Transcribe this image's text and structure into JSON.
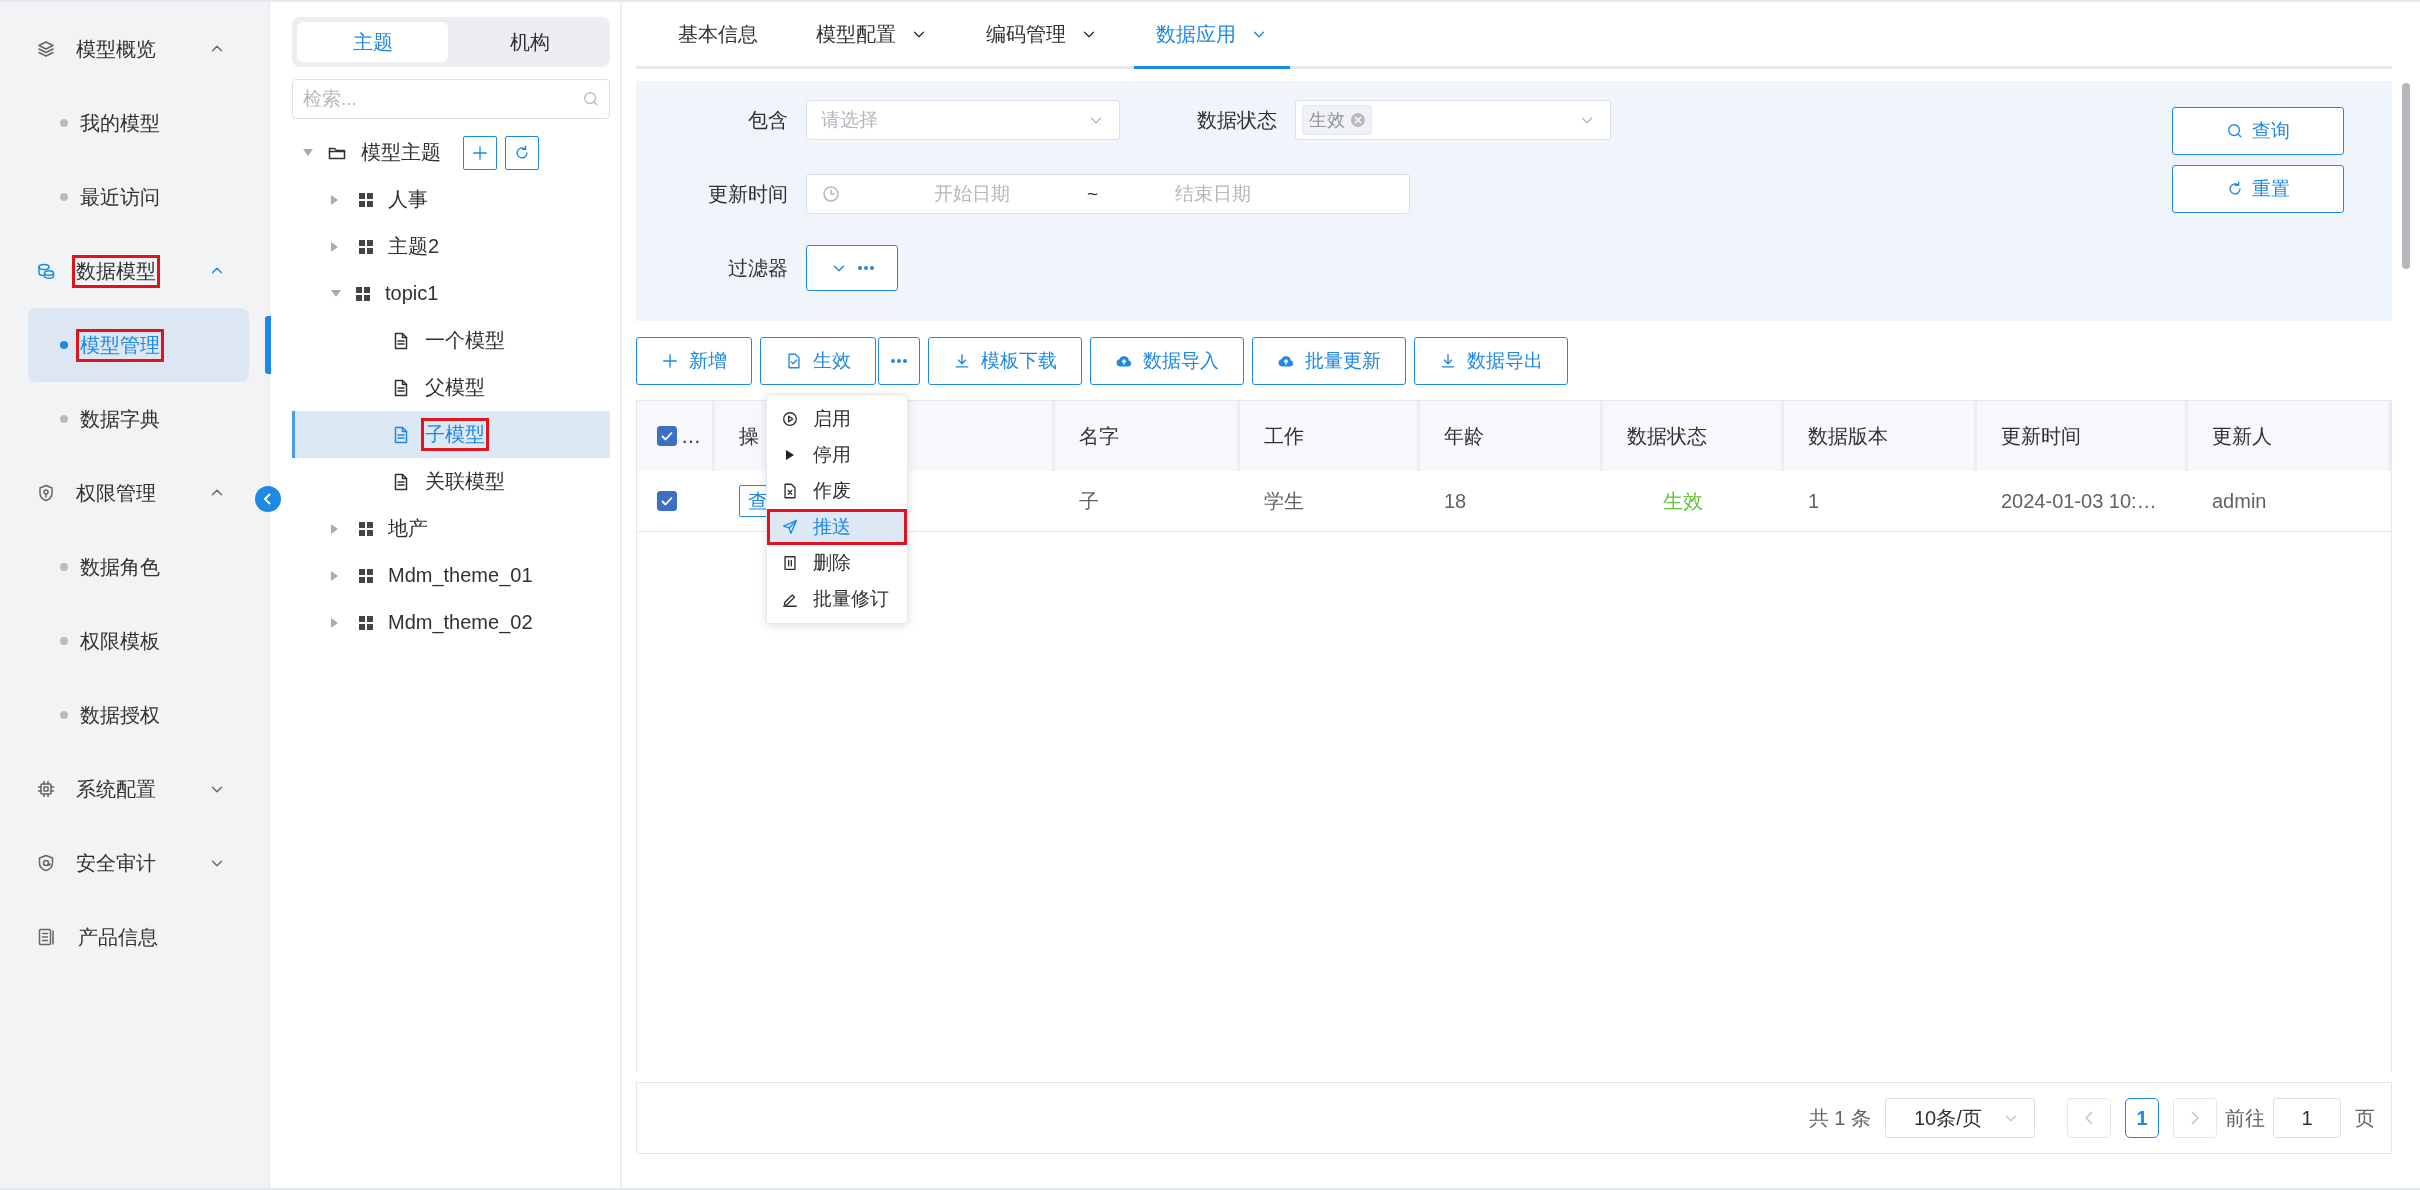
{
  "sidebar": {
    "items": [
      {
        "kind": "group",
        "label": "模型概览",
        "expanded": true,
        "selected": false,
        "highlighted": false
      },
      {
        "kind": "child",
        "label": "我的模型",
        "selected": false,
        "highlighted": false
      },
      {
        "kind": "child",
        "label": "最近访问",
        "selected": false,
        "highlighted": false
      },
      {
        "kind": "group",
        "label": "数据模型",
        "expanded": true,
        "selected": true,
        "highlighted": true
      },
      {
        "kind": "child",
        "label": "模型管理",
        "selected": true,
        "highlighted": true
      },
      {
        "kind": "child",
        "label": "数据字典",
        "selected": false,
        "highlighted": false
      },
      {
        "kind": "group",
        "label": "权限管理",
        "expanded": true,
        "selected": false,
        "highlighted": false
      },
      {
        "kind": "child",
        "label": "数据角色",
        "selected": false,
        "highlighted": false
      },
      {
        "kind": "child",
        "label": "权限模板",
        "selected": false,
        "highlighted": false
      },
      {
        "kind": "child",
        "label": "数据授权",
        "selected": false,
        "highlighted": false
      },
      {
        "kind": "group",
        "label": "系统配置",
        "expanded": false,
        "selected": false,
        "highlighted": false
      },
      {
        "kind": "group",
        "label": "安全审计",
        "expanded": false,
        "selected": false,
        "highlighted": false
      },
      {
        "kind": "link",
        "label": "产品信息",
        "selected": false,
        "highlighted": false
      }
    ]
  },
  "tree_panel": {
    "tabs": [
      {
        "label": "主题",
        "selected": true
      },
      {
        "label": "机构",
        "selected": false
      }
    ],
    "search": {
      "placeholder": "检索..."
    },
    "nodes": [
      {
        "kind": "root",
        "label": "模型主题",
        "expanded": true,
        "selected": false,
        "highlighted": false,
        "children": [
          {
            "kind": "topic",
            "label": "人事",
            "expanded": false,
            "selected": false,
            "highlighted": false
          },
          {
            "kind": "topic",
            "label": "主题2",
            "expanded": false,
            "selected": false,
            "highlighted": false
          },
          {
            "kind": "topic",
            "label": "topic1",
            "expanded": true,
            "selected": false,
            "highlighted": false,
            "children": [
              {
                "kind": "model",
                "label": "一个模型",
                "selected": false,
                "highlighted": false
              },
              {
                "kind": "model",
                "label": "父模型",
                "selected": false,
                "highlighted": false
              },
              {
                "kind": "model",
                "label": "子模型",
                "selected": true,
                "highlighted": true
              },
              {
                "kind": "model",
                "label": "关联模型",
                "selected": false,
                "highlighted": false
              }
            ]
          },
          {
            "kind": "topic",
            "label": "地产",
            "expanded": false,
            "selected": false,
            "highlighted": false
          },
          {
            "kind": "topic",
            "label": "Mdm_theme_01",
            "expanded": false,
            "selected": false,
            "highlighted": false
          },
          {
            "kind": "topic",
            "label": "Mdm_theme_02",
            "expanded": false,
            "selected": false,
            "highlighted": false
          }
        ]
      }
    ]
  },
  "tabs": [
    {
      "label": "基本信息",
      "has_menu": false,
      "selected": false
    },
    {
      "label": "模型配置",
      "has_menu": true,
      "selected": false
    },
    {
      "label": "编码管理",
      "has_menu": true,
      "selected": false
    },
    {
      "label": "数据应用",
      "has_menu": true,
      "selected": true
    }
  ],
  "filter": {
    "fields": [
      {
        "kind": "select",
        "label": "包含",
        "placeholder": "请选择"
      },
      {
        "kind": "tags",
        "label": "数据状态",
        "tags": [
          "生效"
        ]
      },
      {
        "kind": "daterange",
        "label": "更新时间",
        "start_placeholder": "开始日期",
        "separator": "~",
        "end_placeholder": "结束日期"
      },
      {
        "kind": "filter",
        "label": "过滤器"
      }
    ],
    "buttons": [
      "查询",
      "重置"
    ]
  },
  "toolbar": {
    "buttons": [
      {
        "kind": "button",
        "label": "新增"
      },
      {
        "kind": "button",
        "label": "生效"
      },
      {
        "kind": "more"
      },
      {
        "kind": "button",
        "label": "模板下载"
      },
      {
        "kind": "button",
        "label": "数据导入"
      },
      {
        "kind": "button",
        "label": "批量更新"
      },
      {
        "kind": "button",
        "label": "数据导出"
      }
    ],
    "menu": {
      "items": [
        {
          "label": "启用",
          "selected": false,
          "highlighted": false
        },
        {
          "label": "停用",
          "selected": false,
          "highlighted": false
        },
        {
          "label": "作废",
          "selected": false,
          "highlighted": false
        },
        {
          "label": "推送",
          "selected": true,
          "highlighted": true
        },
        {
          "label": "删除",
          "selected": false,
          "highlighted": false
        },
        {
          "label": "批量修订",
          "selected": false,
          "highlighted": false
        }
      ]
    }
  },
  "table": {
    "select_all": {
      "checked": true,
      "label": "…"
    },
    "columns": [
      "操",
      "名字",
      "工作",
      "年龄",
      "数据状态",
      "数据版本",
      "更新时间",
      "更新人"
    ],
    "rows": [
      {
        "checked": true,
        "cells": [
          {
            "kind": "button",
            "text": "查"
          },
          {
            "kind": "text",
            "text": "子"
          },
          {
            "kind": "text",
            "text": "学生"
          },
          {
            "kind": "text",
            "text": "18"
          },
          {
            "kind": "status",
            "text": "生效"
          },
          {
            "kind": "text",
            "text": "1"
          },
          {
            "kind": "text",
            "text": "2024-01-03 10:…"
          },
          {
            "kind": "text",
            "text": "admin"
          }
        ]
      }
    ]
  },
  "pagination": {
    "total": "共 1 条",
    "page_size": "10条/页",
    "pages": [
      {
        "label": "1",
        "selected": true
      }
    ],
    "goto_label": "前往",
    "goto_value": "1",
    "goto_suffix": "页"
  }
}
